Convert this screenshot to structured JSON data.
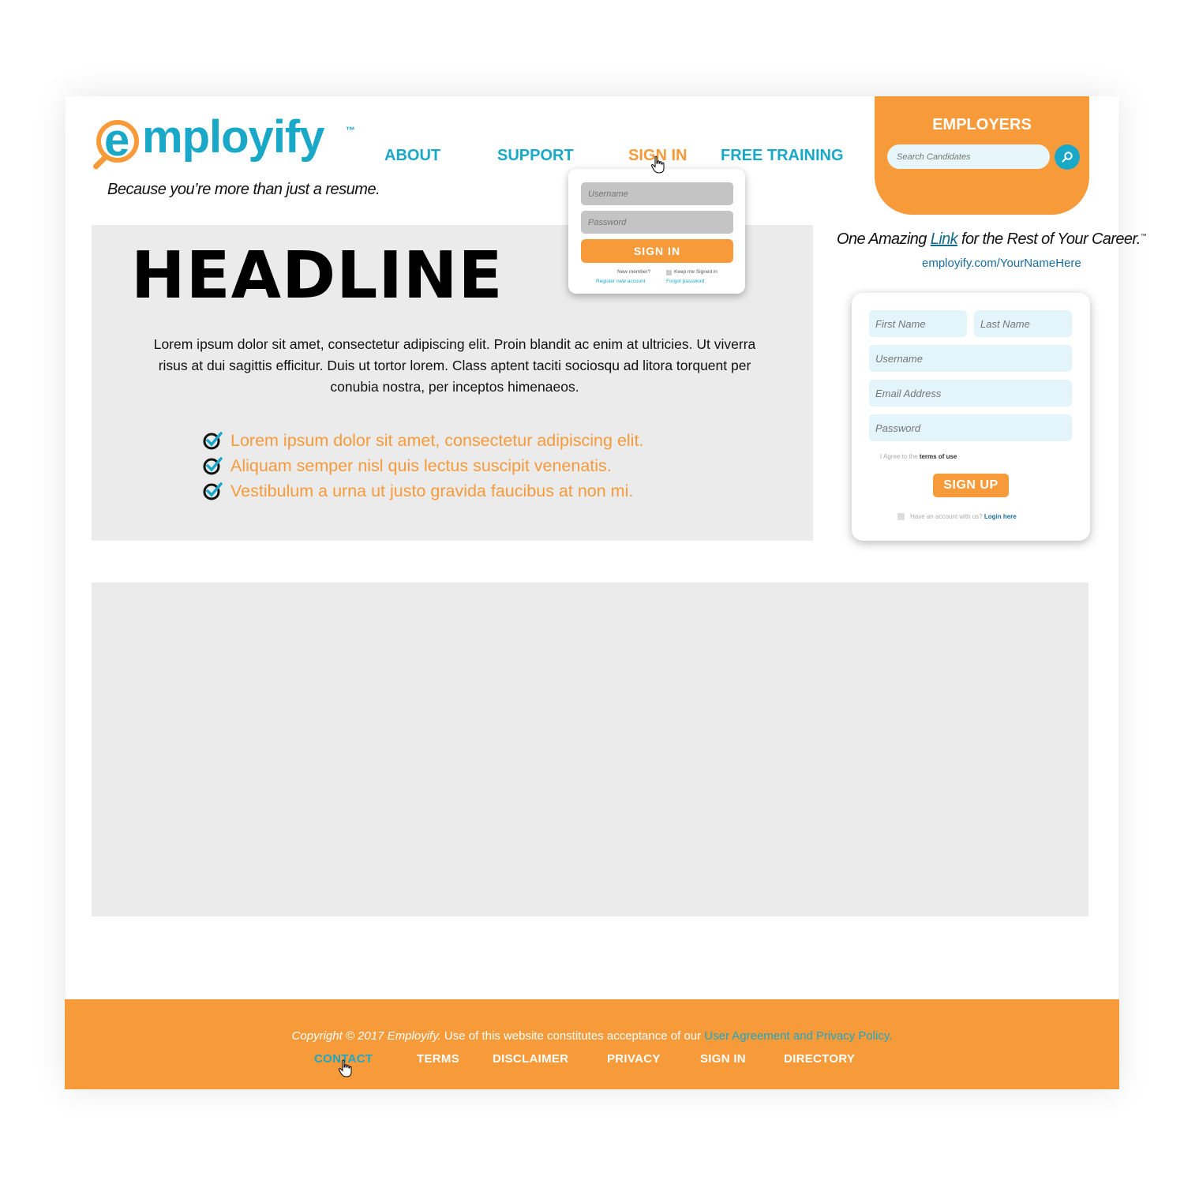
{
  "logo": {
    "word": "mploy",
    "word2": "ify",
    "e": "e",
    "tm": "™",
    "tagline": "Because you’re more than just a resume."
  },
  "nav": {
    "about": "ABOUT",
    "support": "SUPPORT",
    "sign_in": "SIGN IN",
    "free_training": "FREE TRAINING"
  },
  "employers": {
    "title": "EMPLOYERS",
    "search_placeholder": "Search Candidates"
  },
  "career": {
    "pre": "One Amazing ",
    "link": "Link",
    "post": " for the Rest of Your Career.",
    "tm": "™",
    "url": "employify.com/YourNameHere"
  },
  "hero": {
    "headline": "HEADLINE",
    "body": "Lorem ipsum dolor sit amet, consectetur adipiscing elit. Proin blandit ac enim at ultricies. Ut viverra risus at dui sagittis efficitur. Duis ut tortor lorem. Class aptent taciti sociosqu ad litora torquent per conubia nostra, per inceptos himenaeos.",
    "bullets": [
      "Lorem ipsum dolor sit amet, consectetur adipiscing elit.",
      "Aliquam semper nisl quis lectus suscipit venenatis.",
      "Vestibulum a urna ut justo gravida faucibus at non mi."
    ]
  },
  "signin_popup": {
    "username_placeholder": "Username",
    "password_placeholder": "Password",
    "button": "SIGN IN",
    "new_member": "New member?",
    "register": "Register new account",
    "keep_signed": "Keep me Signed in",
    "forgot": "Forgot password"
  },
  "signup": {
    "first_name": "First Name",
    "last_name": "Last Name",
    "username": "Username",
    "email": "Email Address",
    "password": "Password",
    "agree_pre": "I Agree to the ",
    "agree_terms": "terms of use",
    "button": "SIGN UP",
    "have_account": "Have an account with us? ",
    "login_here": "Login here"
  },
  "footer": {
    "copy_italic": "Copyright © 2017 Employify.",
    "copy_rest": " Use of this website constitutes acceptance of our ",
    "copy_link": "User Agreement and Privacy Policy.",
    "links": [
      "CONTACT",
      "TERMS",
      "DISCLAIMER",
      "PRIVACY",
      "SIGN IN",
      "DIRECTORY"
    ]
  },
  "colors": {
    "orange": "#f79a3a",
    "teal": "#19a8c8",
    "gray": "#ebebeb"
  },
  "icons": {
    "search": "search-icon",
    "check": "check-icon",
    "cursor": "hand-cursor-icon"
  }
}
